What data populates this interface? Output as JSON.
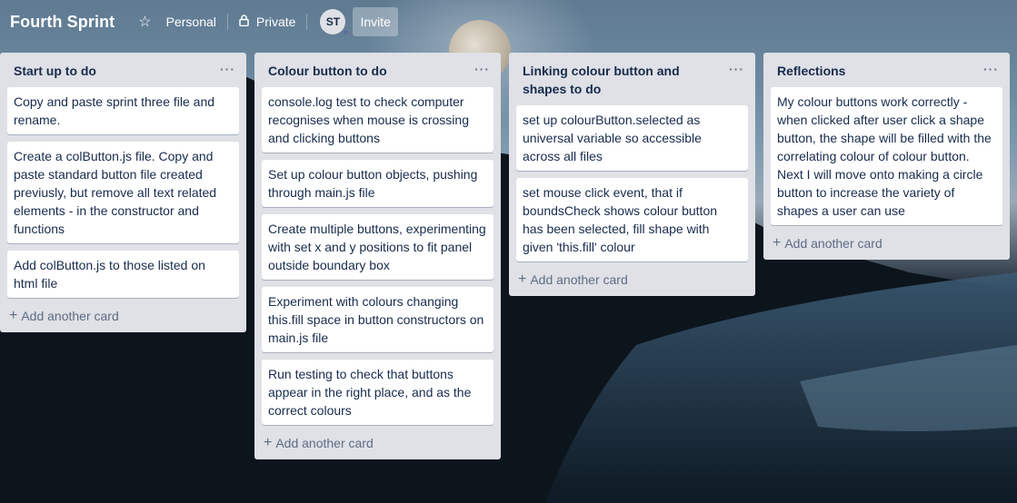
{
  "board": {
    "title": "Fourth Sprint",
    "team_label": "Personal",
    "visibility_label": "Private",
    "member_initials": "ST",
    "invite_label": "Invite"
  },
  "icons": {
    "star": "star-icon",
    "lock": "lock-icon",
    "plus": "plus-icon",
    "more": "ellipsis-icon"
  },
  "lists": [
    {
      "title": "Start up to do",
      "cards": [
        "Copy and paste sprint three file and rename.",
        "Create a colButton.js file. Copy and paste standard button file created previusly, but remove all text related elements - in the constructor and functions",
        "Add colButton.js to those listed on html file"
      ],
      "add_label": "Add another card"
    },
    {
      "title": "Colour button to do",
      "cards": [
        "console.log test to check computer recognises when mouse is crossing and clicking buttons",
        "Set up colour button objects, pushing through main.js file",
        "Create multiple buttons, experimenting with set x and y positions to fit panel outside boundary box",
        "Experiment with colours changing this.fill space in button constructors on main.js file",
        "Run testing to check that buttons appear in the right place, and as the correct colours"
      ],
      "add_label": "Add another card"
    },
    {
      "title": "Linking colour button and shapes to do",
      "cards": [
        "set up colourButton.selected as universal variable so accessible across all files",
        "set mouse click event, that if boundsCheck shows colour button has been selected, fill shape with given 'this.fill' colour"
      ],
      "add_label": "Add another card"
    },
    {
      "title": "Reflections",
      "cards": [
        "My colour buttons work correctly - when clicked after user click a shape button, the shape will be filled with the correlating colour of colour button. Next I will move onto making a circle button to increase the variety of shapes a user can use"
      ],
      "add_label": "Add another card"
    }
  ],
  "colors": {
    "list_bg": "#dfe1e6",
    "card_bg": "#ffffff",
    "text": "#172b4d",
    "muted": "#5e6c84"
  }
}
